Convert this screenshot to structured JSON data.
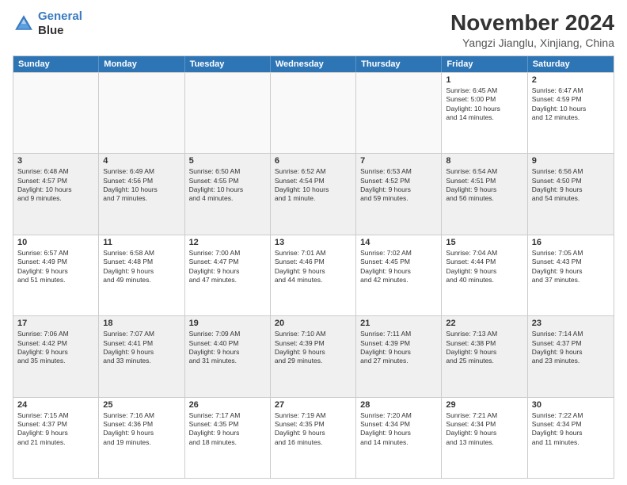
{
  "logo": {
    "line1": "General",
    "line2": "Blue"
  },
  "title": "November 2024",
  "subtitle": "Yangzi Jianglu, Xinjiang, China",
  "weekdays": [
    "Sunday",
    "Monday",
    "Tuesday",
    "Wednesday",
    "Thursday",
    "Friday",
    "Saturday"
  ],
  "rows": [
    [
      {
        "day": "",
        "info": ""
      },
      {
        "day": "",
        "info": ""
      },
      {
        "day": "",
        "info": ""
      },
      {
        "day": "",
        "info": ""
      },
      {
        "day": "",
        "info": ""
      },
      {
        "day": "1",
        "info": "Sunrise: 6:45 AM\nSunset: 5:00 PM\nDaylight: 10 hours\nand 14 minutes."
      },
      {
        "day": "2",
        "info": "Sunrise: 6:47 AM\nSunset: 4:59 PM\nDaylight: 10 hours\nand 12 minutes."
      }
    ],
    [
      {
        "day": "3",
        "info": "Sunrise: 6:48 AM\nSunset: 4:57 PM\nDaylight: 10 hours\nand 9 minutes."
      },
      {
        "day": "4",
        "info": "Sunrise: 6:49 AM\nSunset: 4:56 PM\nDaylight: 10 hours\nand 7 minutes."
      },
      {
        "day": "5",
        "info": "Sunrise: 6:50 AM\nSunset: 4:55 PM\nDaylight: 10 hours\nand 4 minutes."
      },
      {
        "day": "6",
        "info": "Sunrise: 6:52 AM\nSunset: 4:54 PM\nDaylight: 10 hours\nand 1 minute."
      },
      {
        "day": "7",
        "info": "Sunrise: 6:53 AM\nSunset: 4:52 PM\nDaylight: 9 hours\nand 59 minutes."
      },
      {
        "day": "8",
        "info": "Sunrise: 6:54 AM\nSunset: 4:51 PM\nDaylight: 9 hours\nand 56 minutes."
      },
      {
        "day": "9",
        "info": "Sunrise: 6:56 AM\nSunset: 4:50 PM\nDaylight: 9 hours\nand 54 minutes."
      }
    ],
    [
      {
        "day": "10",
        "info": "Sunrise: 6:57 AM\nSunset: 4:49 PM\nDaylight: 9 hours\nand 51 minutes."
      },
      {
        "day": "11",
        "info": "Sunrise: 6:58 AM\nSunset: 4:48 PM\nDaylight: 9 hours\nand 49 minutes."
      },
      {
        "day": "12",
        "info": "Sunrise: 7:00 AM\nSunset: 4:47 PM\nDaylight: 9 hours\nand 47 minutes."
      },
      {
        "day": "13",
        "info": "Sunrise: 7:01 AM\nSunset: 4:46 PM\nDaylight: 9 hours\nand 44 minutes."
      },
      {
        "day": "14",
        "info": "Sunrise: 7:02 AM\nSunset: 4:45 PM\nDaylight: 9 hours\nand 42 minutes."
      },
      {
        "day": "15",
        "info": "Sunrise: 7:04 AM\nSunset: 4:44 PM\nDaylight: 9 hours\nand 40 minutes."
      },
      {
        "day": "16",
        "info": "Sunrise: 7:05 AM\nSunset: 4:43 PM\nDaylight: 9 hours\nand 37 minutes."
      }
    ],
    [
      {
        "day": "17",
        "info": "Sunrise: 7:06 AM\nSunset: 4:42 PM\nDaylight: 9 hours\nand 35 minutes."
      },
      {
        "day": "18",
        "info": "Sunrise: 7:07 AM\nSunset: 4:41 PM\nDaylight: 9 hours\nand 33 minutes."
      },
      {
        "day": "19",
        "info": "Sunrise: 7:09 AM\nSunset: 4:40 PM\nDaylight: 9 hours\nand 31 minutes."
      },
      {
        "day": "20",
        "info": "Sunrise: 7:10 AM\nSunset: 4:39 PM\nDaylight: 9 hours\nand 29 minutes."
      },
      {
        "day": "21",
        "info": "Sunrise: 7:11 AM\nSunset: 4:39 PM\nDaylight: 9 hours\nand 27 minutes."
      },
      {
        "day": "22",
        "info": "Sunrise: 7:13 AM\nSunset: 4:38 PM\nDaylight: 9 hours\nand 25 minutes."
      },
      {
        "day": "23",
        "info": "Sunrise: 7:14 AM\nSunset: 4:37 PM\nDaylight: 9 hours\nand 23 minutes."
      }
    ],
    [
      {
        "day": "24",
        "info": "Sunrise: 7:15 AM\nSunset: 4:37 PM\nDaylight: 9 hours\nand 21 minutes."
      },
      {
        "day": "25",
        "info": "Sunrise: 7:16 AM\nSunset: 4:36 PM\nDaylight: 9 hours\nand 19 minutes."
      },
      {
        "day": "26",
        "info": "Sunrise: 7:17 AM\nSunset: 4:35 PM\nDaylight: 9 hours\nand 18 minutes."
      },
      {
        "day": "27",
        "info": "Sunrise: 7:19 AM\nSunset: 4:35 PM\nDaylight: 9 hours\nand 16 minutes."
      },
      {
        "day": "28",
        "info": "Sunrise: 7:20 AM\nSunset: 4:34 PM\nDaylight: 9 hours\nand 14 minutes."
      },
      {
        "day": "29",
        "info": "Sunrise: 7:21 AM\nSunset: 4:34 PM\nDaylight: 9 hours\nand 13 minutes."
      },
      {
        "day": "30",
        "info": "Sunrise: 7:22 AM\nSunset: 4:34 PM\nDaylight: 9 hours\nand 11 minutes."
      }
    ]
  ]
}
